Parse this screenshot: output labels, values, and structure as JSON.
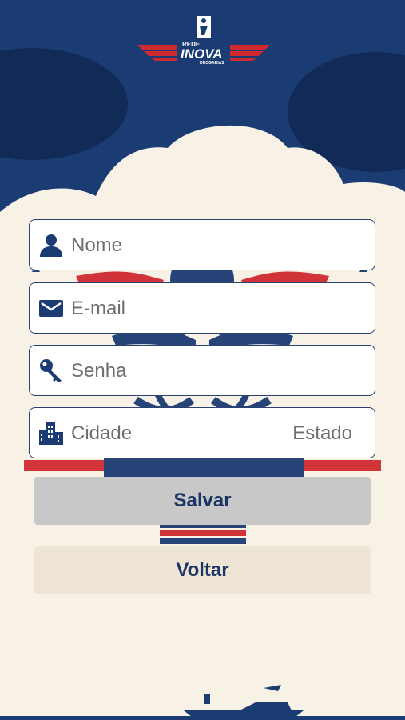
{
  "brand": {
    "line1": "REDE",
    "name": "INOVA",
    "line3": "DROGARIAS"
  },
  "form": {
    "name_placeholder": "Nome",
    "email_placeholder": "E-mail",
    "password_placeholder": "Senha",
    "city_placeholder": "Cidade",
    "state_placeholder": "Estado"
  },
  "actions": {
    "save_label": "Salvar",
    "back_label": "Voltar"
  },
  "colors": {
    "navy": "#1b3a72",
    "red": "#d02a2f",
    "cream": "#f6efe4"
  },
  "icons": [
    "person-icon",
    "mail-icon",
    "key-icon",
    "city-icon"
  ]
}
